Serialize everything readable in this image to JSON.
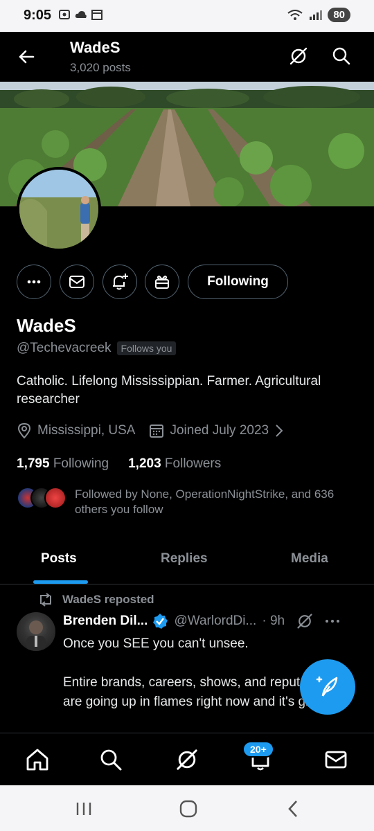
{
  "status": {
    "time": "9:05",
    "battery": "80"
  },
  "header": {
    "name": "WadeS",
    "posts": "3,020 posts"
  },
  "profile": {
    "follow_label": "Following",
    "display_name": "WadeS",
    "handle": "@Techevacreek",
    "follows_you": "Follows you",
    "bio": "Catholic. Lifelong Mississippian. Farmer. Agricultural researcher",
    "location": "Mississippi, USA",
    "joined": "Joined July 2023",
    "following_count": "1,795",
    "following_label": "Following",
    "followers_count": "1,203",
    "followers_label": "Followers",
    "followed_by": "Followed by None, OperationNightStrike, and 636 others you follow"
  },
  "tabs": [
    {
      "label": "Posts",
      "active": true
    },
    {
      "label": "Replies",
      "active": false
    },
    {
      "label": "Media",
      "active": false
    }
  ],
  "post": {
    "repost_label": "WadeS reposted",
    "author_name": "Brenden Dil...",
    "author_handle": "@WarlordDi...",
    "time": "· 9h",
    "text_line1": "Once you SEE you can't unsee.",
    "text_line2": "Entire brands, careers, shows, and reputations are going up in flames right now and it's glorious."
  },
  "bottom_nav": {
    "notifications_badge": "20+"
  },
  "colors": {
    "accent": "#1d9bf0",
    "background": "#000000",
    "muted": "#8b9096"
  },
  "icons": [
    "back-arrow-icon",
    "grok-icon",
    "search-icon",
    "more-icon",
    "mail-icon",
    "notify-icon",
    "gift-icon",
    "location-icon",
    "calendar-icon",
    "chevron-right-icon",
    "repost-icon",
    "verified-icon",
    "compose-icon",
    "home-icon",
    "bell-icon"
  ]
}
